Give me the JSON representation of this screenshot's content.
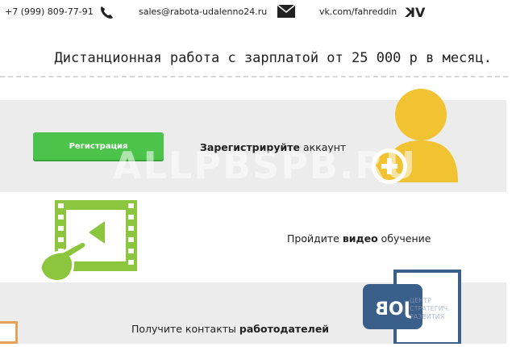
{
  "topbar": {
    "phone": "+7 (999) 809-77-91",
    "email": "sales@rabota-udalenno24.ru",
    "vk": "vk.com/fahreddin"
  },
  "headline": "Дистанционная работа с зарплатой от 25 000 р в месяц.",
  "steps": {
    "register": {
      "text_bold": "Зарегистрируйте",
      "text_rest": " аккаунт",
      "button_label": "Регистрация"
    },
    "video": {
      "text_pre": "Пройдите ",
      "text_bold": "видео",
      "text_rest": " обучение"
    },
    "contacts": {
      "text_pre": "Получите контакты ",
      "text_bold": "работодателей",
      "job_label": "JOB"
    }
  },
  "watermark": "ALLPBSPB.RU",
  "small_watermark": "ЦЕНТР\nСТРАТЕГИЧ.\nРАЗВИТИЯ",
  "colors": {
    "green_button": "#4cc34a",
    "user_icon": "#f1c232",
    "video_icon": "#8cc63f",
    "job_icon": "#3a5f8a",
    "row_grey": "#ececec"
  }
}
